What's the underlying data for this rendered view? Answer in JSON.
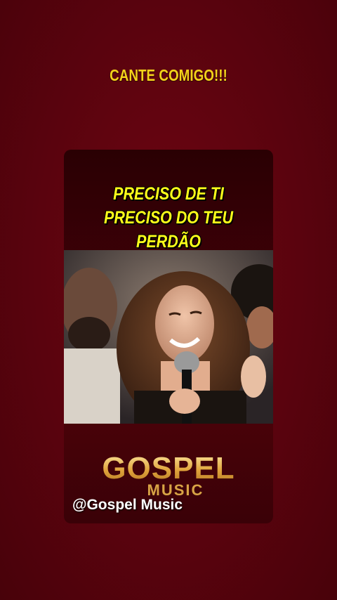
{
  "header": {
    "caption": "CANTE COMIGO!!!"
  },
  "card": {
    "lyrics": [
      "PRECISO DE TI",
      "PRECISO DO TEU PERDÃO"
    ],
    "logo_main": "GOSPEL",
    "logo_sub": "MUSIC",
    "handle": "@Gospel Music"
  },
  "colors": {
    "background": "#5a030e",
    "caption": "#f2d21a",
    "lyrics": "#ffff1a",
    "logo_gold": "#e0a43c"
  }
}
